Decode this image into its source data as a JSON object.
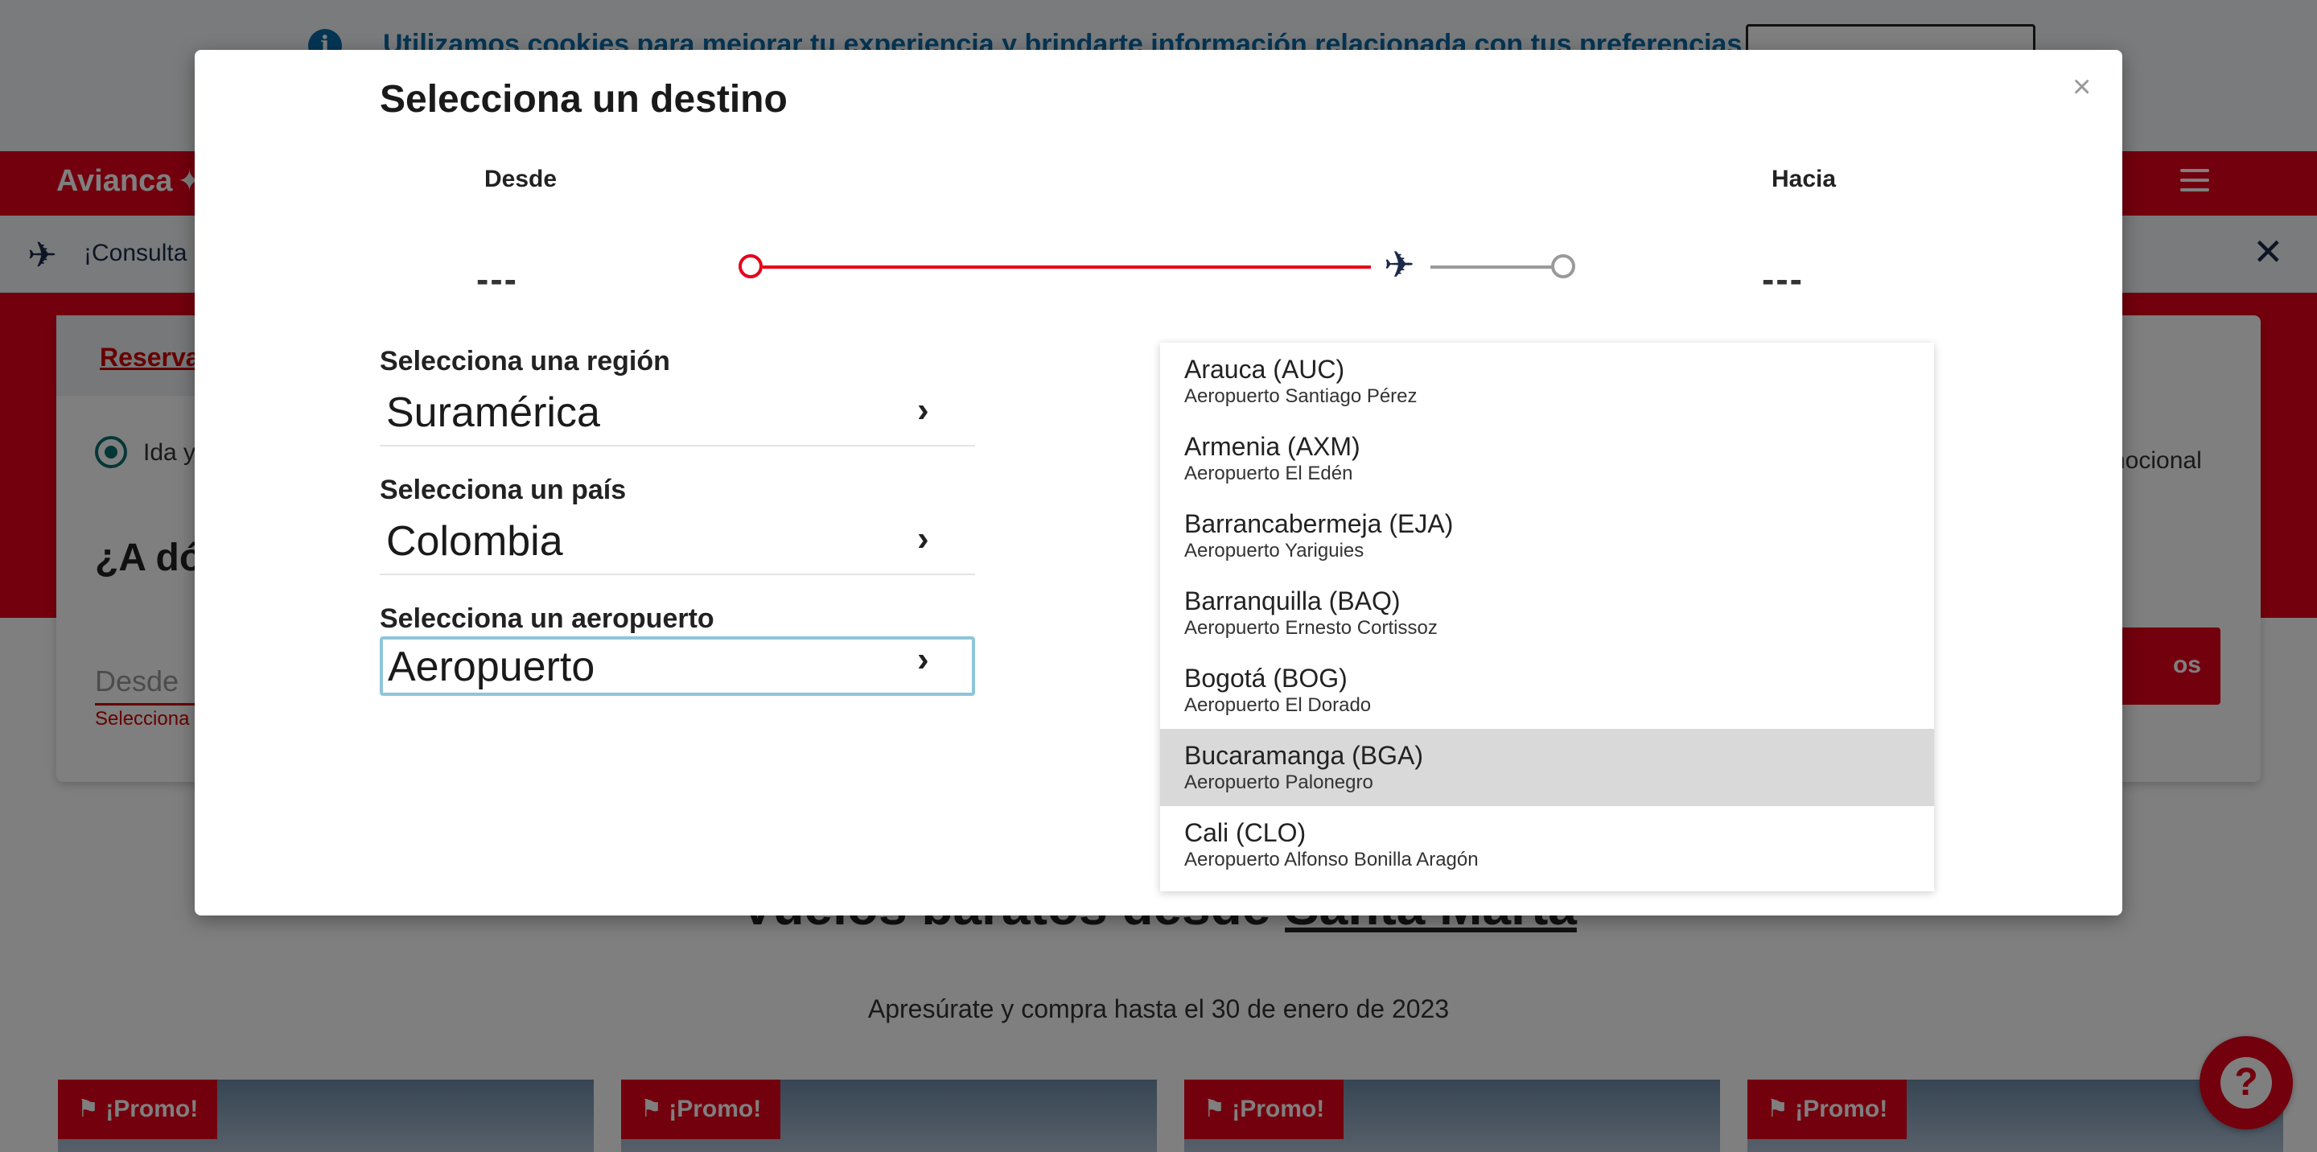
{
  "cookie_bar": {
    "text": "Utilizamos cookies para mejorar tu experiencia y brindarte información relacionada con tus preferencias y hábitos"
  },
  "nav": {
    "logo_text": "Avianca"
  },
  "banner": {
    "text": "¡Consulta"
  },
  "booking": {
    "tab_label": "Reserva",
    "trip_type_label": "Ida y",
    "promo_label": "omocional",
    "where_title": "¿A dó",
    "from_placeholder": "Desde",
    "from_error": "Selecciona u",
    "search_label": "os"
  },
  "deals": {
    "title_prefix": "Vuelos baratos desde ",
    "title_city": "Santa Marta",
    "subtitle": "Apresúrate y compra hasta el 30 de enero de 2023",
    "cards": [
      {
        "tag": "¡Promo!"
      },
      {
        "tag": "¡Promo!"
      },
      {
        "tag": "¡Promo!"
      },
      {
        "tag": "¡Promo!"
      }
    ]
  },
  "modal": {
    "title": "Selecciona un destino",
    "close": "×",
    "from_label": "Desde",
    "to_label": "Hacia",
    "from_code": "---",
    "to_code": "---",
    "region": {
      "label": "Selecciona una región",
      "value": "Suramérica"
    },
    "country": {
      "label": "Selecciona un país",
      "value": "Colombia"
    },
    "airport": {
      "label": "Selecciona un aeropuerto",
      "placeholder": "Aeropuerto"
    },
    "airports": [
      {
        "name": "Arauca (AUC)",
        "airport": "Aeropuerto Santiago Pérez"
      },
      {
        "name": "Armenia (AXM)",
        "airport": "Aeropuerto El Edén"
      },
      {
        "name": "Barrancabermeja (EJA)",
        "airport": "Aeropuerto Yariguies"
      },
      {
        "name": "Barranquilla (BAQ)",
        "airport": "Aeropuerto Ernesto Cortissoz"
      },
      {
        "name": "Bogotá (BOG)",
        "airport": "Aeropuerto El Dorado"
      },
      {
        "name": "Bucaramanga (BGA)",
        "airport": "Aeropuerto Palonegro"
      },
      {
        "name": "Cali (CLO)",
        "airport": "Aeropuerto Alfonso Bonilla Aragón"
      }
    ],
    "highlighted_index": 5
  },
  "colors": {
    "brand_red": "#e6001a",
    "focus_border": "#8ec5d9",
    "highlight": "#d9d9d9"
  }
}
